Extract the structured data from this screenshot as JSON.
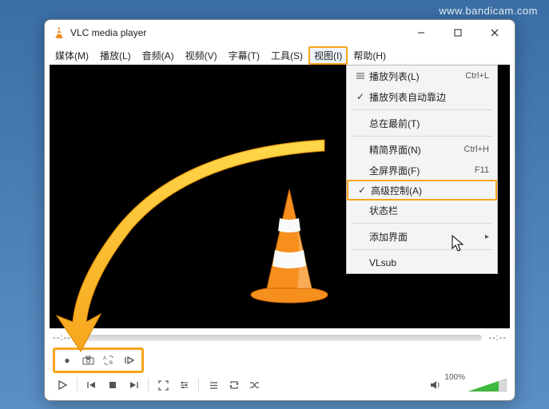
{
  "watermark": "www.bandicam.com",
  "window": {
    "title": "VLC media player"
  },
  "menubar": {
    "items": [
      {
        "label": "媒体(M)"
      },
      {
        "label": "播放(L)"
      },
      {
        "label": "音频(A)"
      },
      {
        "label": "视频(V)"
      },
      {
        "label": "字幕(T)"
      },
      {
        "label": "工具(S)"
      },
      {
        "label": "视图(I)",
        "highlighted": true
      },
      {
        "label": "帮助(H)"
      }
    ]
  },
  "dropdown": {
    "items": [
      {
        "icon": "list",
        "label": "播放列表(L)",
        "shortcut": "Ctrl+L"
      },
      {
        "icon": "check",
        "label": "播放列表自动靠边",
        "shortcut": ""
      },
      {
        "separator": true
      },
      {
        "icon": "",
        "label": "总在最前(T)",
        "shortcut": ""
      },
      {
        "separator": true
      },
      {
        "icon": "",
        "label": "精简界面(N)",
        "shortcut": "Ctrl+H"
      },
      {
        "icon": "",
        "label": "全屏界面(F)",
        "shortcut": "F11"
      },
      {
        "icon": "check",
        "label": "高级控制(A)",
        "shortcut": "",
        "highlighted": true
      },
      {
        "icon": "",
        "label": "状态栏",
        "shortcut": ""
      },
      {
        "separator": true
      },
      {
        "icon": "submenu",
        "label": "添加界面",
        "shortcut": ""
      },
      {
        "separator": true
      },
      {
        "icon": "",
        "label": "VLsub",
        "shortcut": ""
      }
    ]
  },
  "seek": {
    "left_time": "--:--",
    "right_time": "--:--"
  },
  "adv_controls": {
    "record": "●",
    "snapshot": "⎙",
    "loop_ab": "AB",
    "frame": "▷"
  },
  "controls": {
    "play": "▶",
    "prev": "⏮",
    "stop": "■",
    "next": "⏭",
    "fullscreen": "⛶",
    "ext": "≡",
    "playlist": "☰",
    "repeat": "⟳",
    "shuffle": "⤨",
    "volume_icon": "🔊",
    "volume_text": "100%"
  }
}
